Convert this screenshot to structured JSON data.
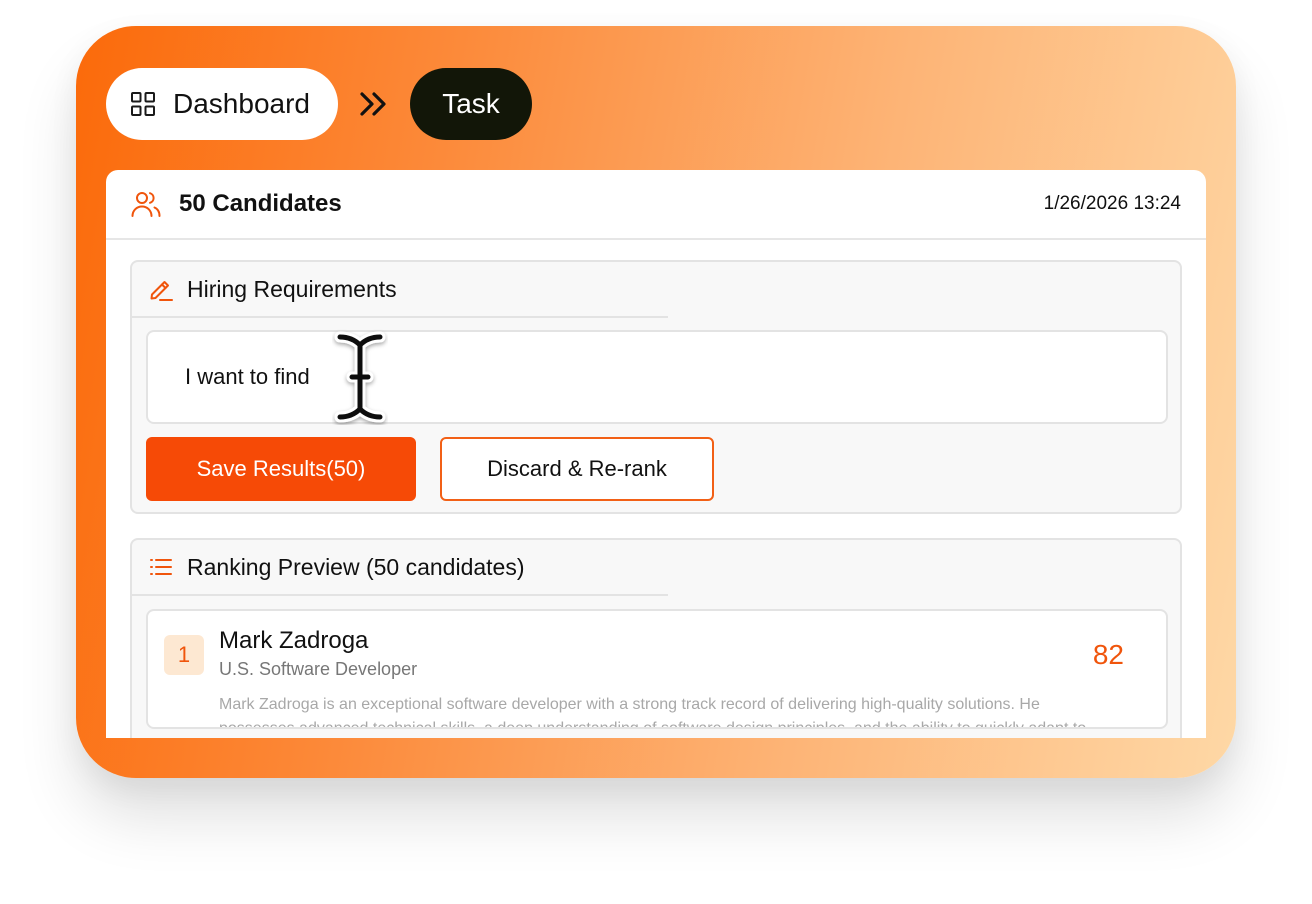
{
  "breadcrumb": {
    "dashboard_label": "Dashboard",
    "dashboard_icon": "grid-icon",
    "separator_icon": "double-chevron-right-icon",
    "task_label": "Task"
  },
  "header": {
    "icon": "users-icon",
    "title": "50 Candidates",
    "timestamp": "1/26/2026 13:24"
  },
  "requirements": {
    "icon": "pencil-icon",
    "title": "Hiring Requirements",
    "input_value": "I want to find",
    "save_label": "Save Results(50)",
    "discard_label": "Discard & Re-rank"
  },
  "ranking": {
    "icon": "list-icon",
    "title": "Ranking Preview (50 candidates)",
    "candidates": [
      {
        "rank": "1",
        "name": "Mark Zadroga",
        "role": "U.S. Software Developer",
        "score": "82",
        "description": "Mark Zadroga is an exceptional software developer with a strong track record of delivering high-quality solutions. He possesses advanced technical skills, a deep understanding of software design principles, and the ability to quickly adapt to"
      }
    ]
  },
  "colors": {
    "accent": "#f64a06",
    "score": "#f0550c",
    "dark_pill": "#121608",
    "gradient_start": "#fb6a0a",
    "gradient_end": "#fed8a6"
  }
}
